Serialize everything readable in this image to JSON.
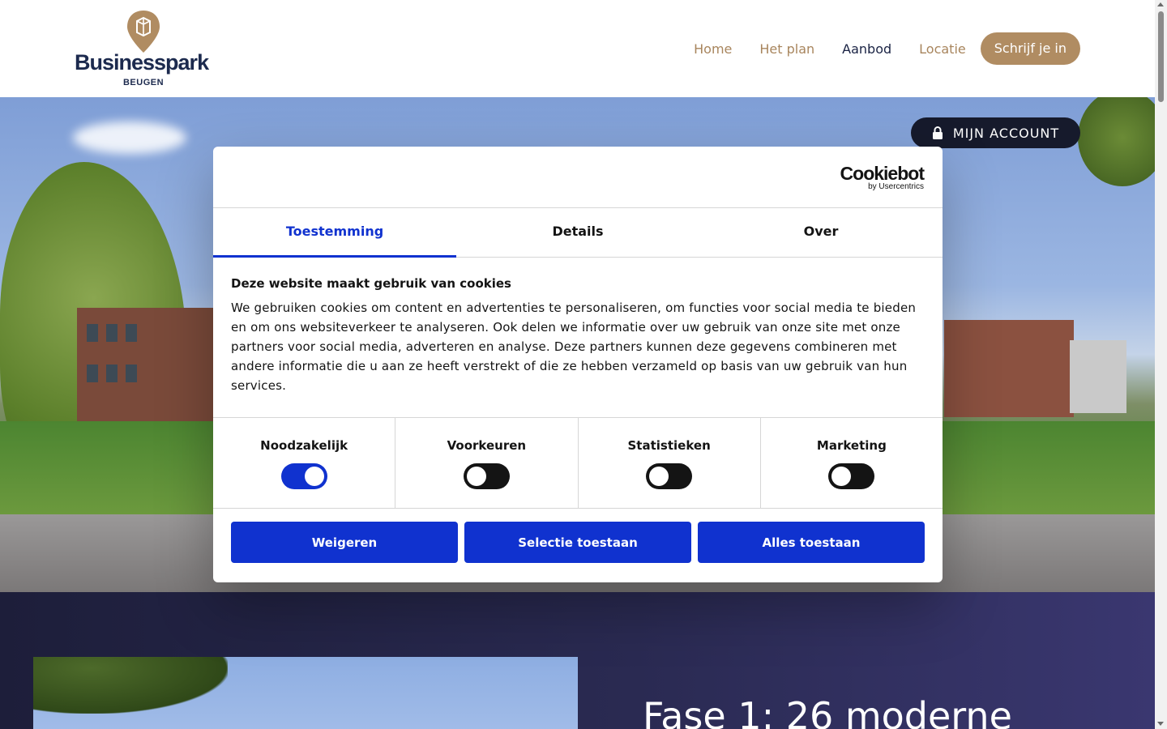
{
  "header": {
    "logo": {
      "name": "Businesspark",
      "subtitle": "BEUGEN"
    },
    "nav": [
      {
        "label": "Home",
        "active": false
      },
      {
        "label": "Het plan",
        "active": false
      },
      {
        "label": "Aanbod",
        "active": true
      },
      {
        "label": "Locatie",
        "active": false
      }
    ],
    "cta_label": "Schrijf je in",
    "brand_color": "#b08c62",
    "nav_active_color": "#1a2344"
  },
  "hero": {
    "account_label": "MIJN ACCOUNT",
    "account_icon": "lock-icon"
  },
  "lower": {
    "title": "Fase 1: 26 moderne"
  },
  "cookie_dialog": {
    "provider": {
      "name": "Cookiebot",
      "by": "by Usercentrics"
    },
    "tabs": [
      {
        "label": "Toestemming",
        "active": true
      },
      {
        "label": "Details",
        "active": false
      },
      {
        "label": "Over",
        "active": false
      }
    ],
    "heading": "Deze website maakt gebruik van cookies",
    "body": "We gebruiken cookies om content en advertenties te personaliseren, om functies voor social media te bieden en om ons websiteverkeer te analyseren. Ook delen we informatie over uw gebruik van onze site met onze partners voor social media, adverteren en analyse. Deze partners kunnen deze gegevens combineren met andere informatie die u aan ze heeft verstrekt of die ze hebben verzameld op basis van uw gebruik van hun services.",
    "toggles": [
      {
        "label": "Noodzakelijk",
        "on": true
      },
      {
        "label": "Voorkeuren",
        "on": false
      },
      {
        "label": "Statistieken",
        "on": false
      },
      {
        "label": "Marketing",
        "on": false
      }
    ],
    "buttons": {
      "reject": "Weigeren",
      "selection": "Selectie toestaan",
      "all": "Alles toestaan"
    },
    "accent_color": "#1032cf"
  }
}
